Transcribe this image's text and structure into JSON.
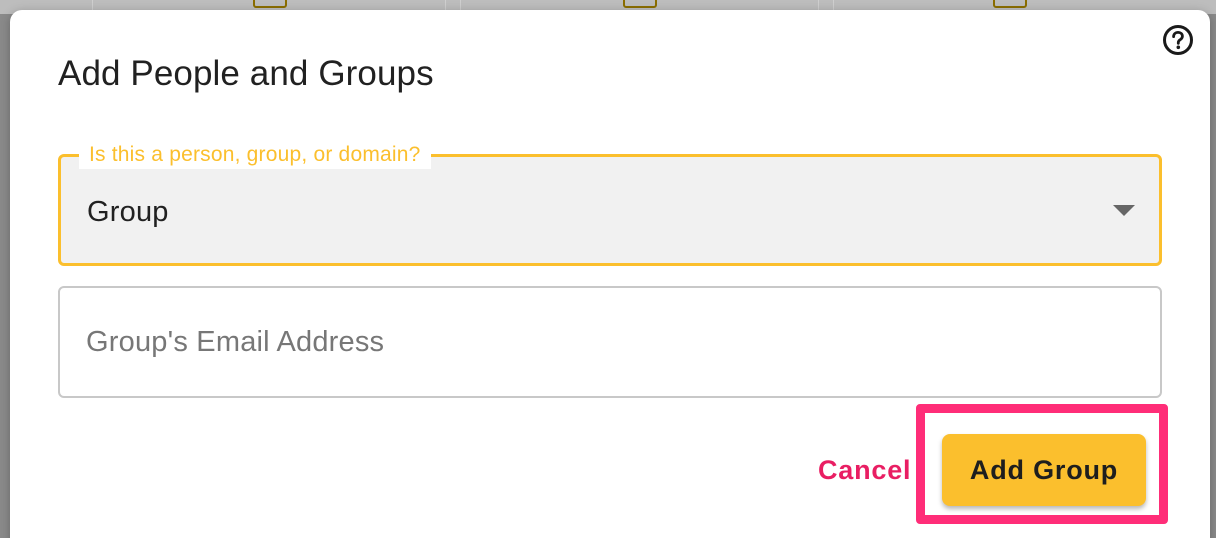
{
  "dialog": {
    "title": "Add People and Groups",
    "help_icon": "help-circle-icon"
  },
  "type_select": {
    "label": "Is this a person, group, or domain?",
    "value": "Group",
    "arrow_icon": "dropdown-arrow-icon"
  },
  "email_field": {
    "value": "",
    "placeholder": "Group's Email Address"
  },
  "actions": {
    "cancel_label": "Cancel",
    "add_label": "Add Group"
  },
  "colors": {
    "accent": "#fbbf2d",
    "cancel_text": "#e91e63",
    "highlight": "#ff2d78"
  }
}
